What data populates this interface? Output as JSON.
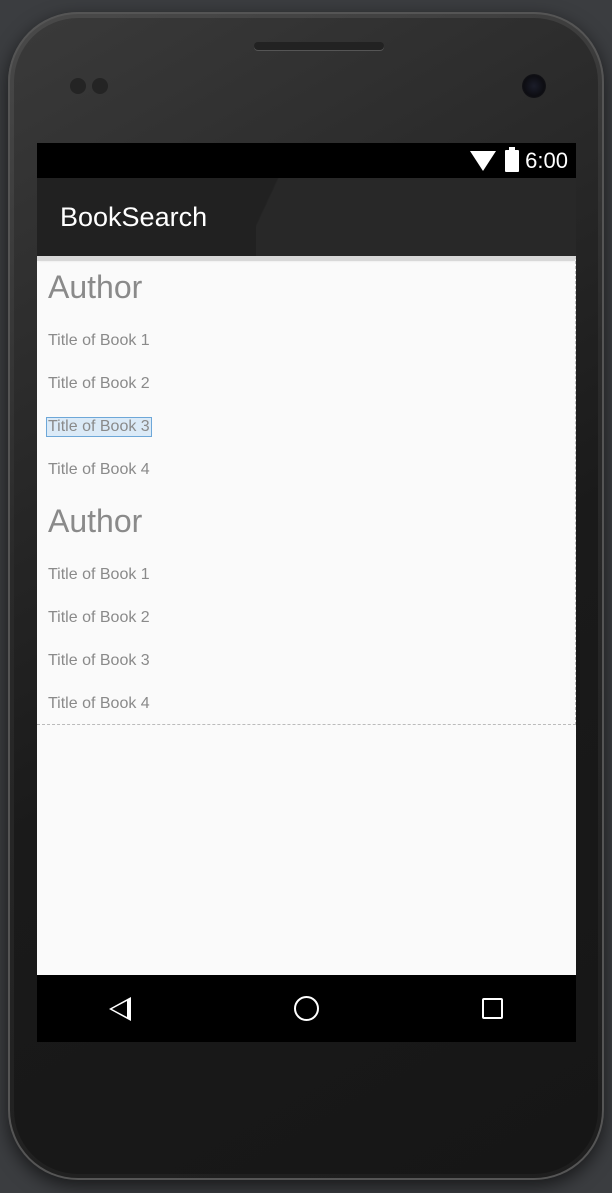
{
  "status_bar": {
    "time": "6:00",
    "icons": [
      "wifi-icon",
      "battery-icon"
    ]
  },
  "app_bar": {
    "title": "BookSearch"
  },
  "list": [
    {
      "author": "Author",
      "books": [
        "Title of Book 1",
        "Title of Book 2",
        "Title of Book 3",
        "Title of Book 4"
      ]
    },
    {
      "author": "Author",
      "books": [
        "Title of Book 1",
        "Title of Book 2",
        "Title of Book 3",
        "Title of Book 4"
      ]
    }
  ],
  "selected": "Title of Book 3",
  "nav_bar": {
    "icons": [
      "back-icon",
      "home-icon",
      "recent-apps-icon"
    ]
  },
  "colors": {
    "app_bar": "#212121",
    "text": "#8a8a8a",
    "selection": "#dbeaf7",
    "background": "#fafafa"
  }
}
